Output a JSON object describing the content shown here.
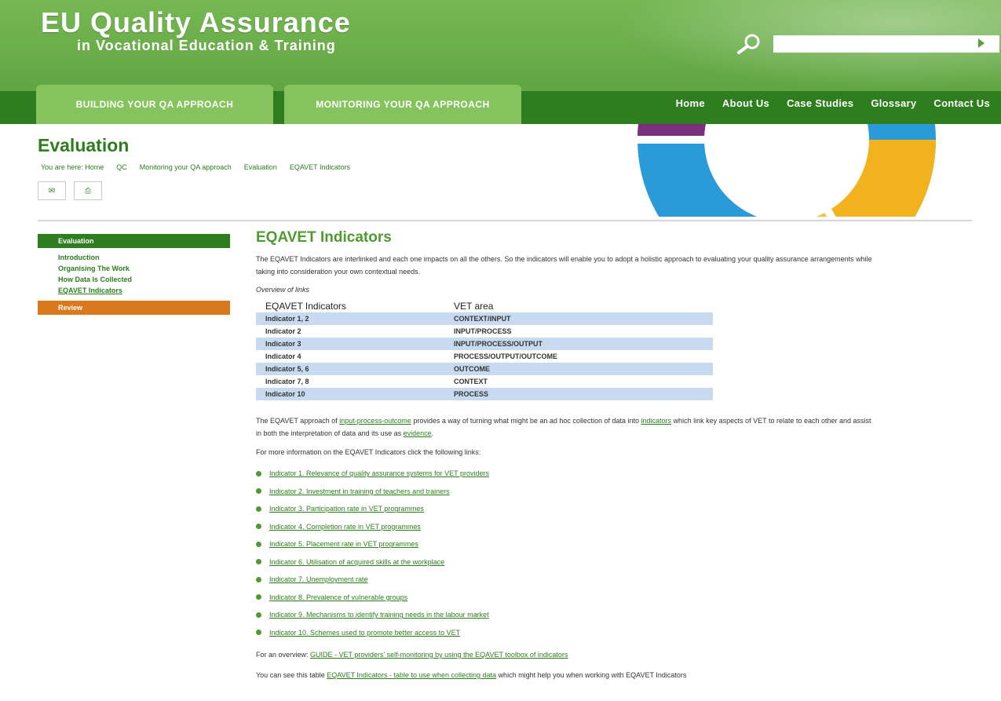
{
  "header": {
    "title": "EU Quality Assurance",
    "subtitle": "in Vocational Education & Training",
    "search_placeholder": ""
  },
  "tabs": [
    {
      "label": "BUILDING YOUR QA APPROACH"
    },
    {
      "label": "MONITORING YOUR QA APPROACH"
    }
  ],
  "topnav": [
    "Home",
    "About Us",
    "Case Studies",
    "Glossary",
    "Contact Us"
  ],
  "page": {
    "title": "Evaluation",
    "breadcrumb": [
      "You are here: Home",
      "QC",
      "Monitoring your QA approach",
      "Evaluation",
      "EQAVET Indicators"
    ],
    "tools": [
      "✉",
      "⎙"
    ]
  },
  "sidebar": {
    "heading": "Evaluation",
    "items": [
      "Introduction",
      "Organising The Work",
      "How Data Is Collected",
      "EQAVET Indicators"
    ],
    "review": "Review"
  },
  "main": {
    "heading": "EQAVET Indicators",
    "intro": "The EQAVET Indicators are interlinked and each one impacts on all the others. So the indicators will enable you to adopt a holistic approach to evaluating your quality assurance arrangements while taking into consideration your own contextual needs.",
    "overview_label": "Overview of links",
    "table": {
      "headers": [
        "EQAVET Indicators",
        "VET area"
      ],
      "rows": [
        [
          "Indicator 1, 2",
          "CONTEXT/INPUT"
        ],
        [
          "Indicator 2",
          "INPUT/PROCESS"
        ],
        [
          "Indicator 3",
          "INPUT/PROCESS/OUTPUT"
        ],
        [
          "Indicator 4",
          "PROCESS/OUTPUT/OUTCOME"
        ],
        [
          "Indicator 5, 6",
          "OUTCOME"
        ],
        [
          "Indicator 7, 8",
          "CONTEXT"
        ],
        [
          "Indicator 10",
          "PROCESS"
        ]
      ]
    },
    "approach_pre": "The EQAVET approach of",
    "approach_link": "input-process-outcome",
    "approach_mid": "provides a way of turning what might be an ad hoc collection of data into",
    "approach_link2": "indicators",
    "approach_post": "which link key aspects of VET to relate to each other and assist in both the interpretation of data and its use as",
    "approach_link3": "evidence",
    "more_info": "For more information on the EQAVET Indicators click the following links:",
    "links": [
      "Indicator 1. Relevance of quality assurance systems for VET providers",
      "Indicator 2. Investment in training of teachers and trainers",
      "Indicator 3. Participation rate in VET programmes",
      "Indicator 4. Completion rate in VET programmes",
      "Indicator 5. Placement rate in VET programmes",
      "Indicator 6. Utilisation of acquired skills at the workplace",
      "Indicator 7. Unemployment rate",
      "Indicator 8. Prevalence of vulnerable groups",
      "Indicator 9. Mechanisms to identify training needs in the labour market",
      "Indicator 10. Schemes used to promote better access to VET"
    ],
    "overview_pre": "For an overview:",
    "overview_link": "GUIDE - VET providers' self-monitoring by using the EQAVET toolbox of indicators",
    "print_pre": "You can see this table",
    "print_link": "EQAVET Indicators - table to use when collecting data",
    "print_post": "which might help you when working with EQAVET Indicators"
  },
  "colors": {
    "brand_green": "#2e7d1e",
    "header_green": "#6aad47",
    "tab_green": "#86c35e",
    "review_orange": "#d9781c",
    "table_row": "#c8daf0"
  }
}
